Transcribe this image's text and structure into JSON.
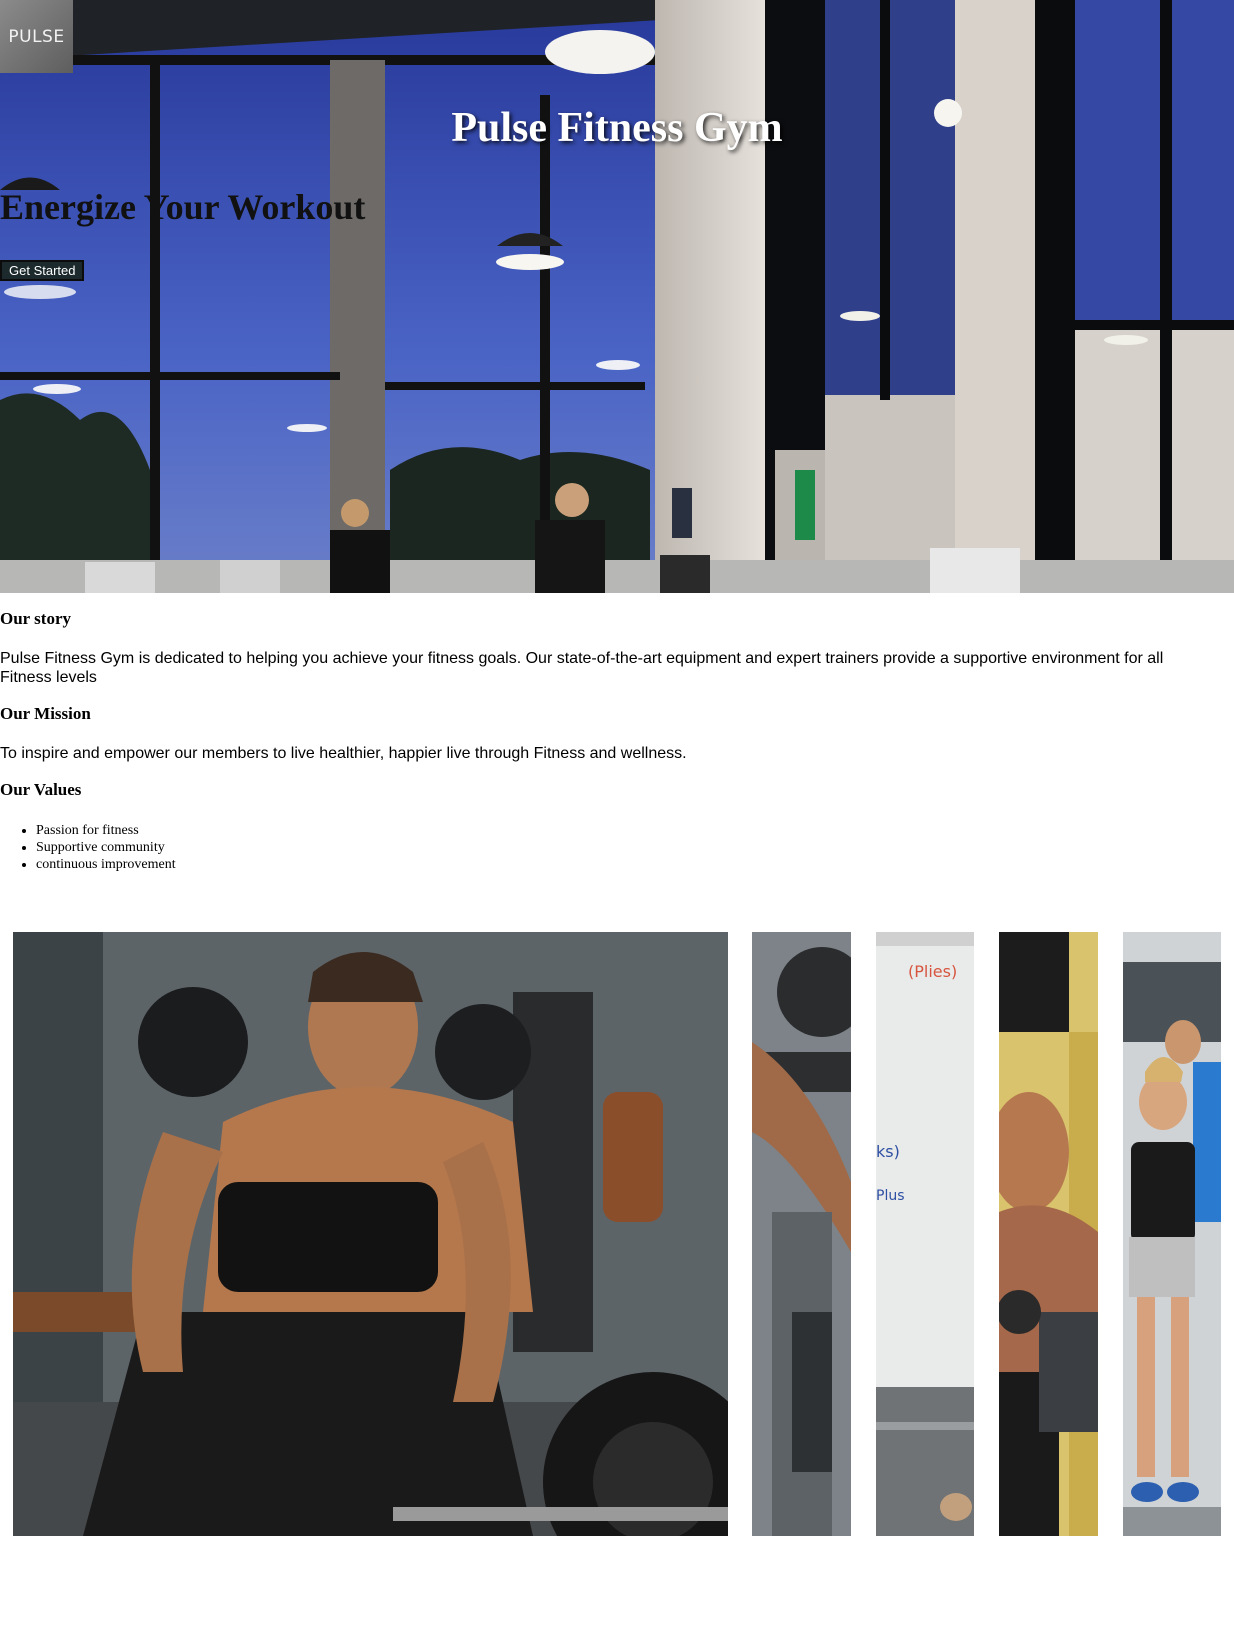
{
  "brand": {
    "logo_text": "PULSE"
  },
  "hero": {
    "title": "Pulse Fitness Gym",
    "tagline": "Energize Your Workout",
    "cta_label": "Get Started"
  },
  "about": {
    "story_heading": "Our story",
    "story_text": "Pulse Fitness Gym is dedicated to helping you achieve your fitness goals. Our state-of-the-art equipment and expert trainers provide a supportive environment for all Fitness levels",
    "mission_heading": "Our Mission",
    "mission_text": "To inspire and empower our members to live healthier, happier live through Fitness and wellness.",
    "values_heading": "Our Values",
    "values": [
      "Passion for fitness",
      "Supportive community",
      "continuous improvement"
    ]
  },
  "gallery": {
    "images": [
      {
        "name": "woman-deadlift-photo"
      },
      {
        "name": "dumbbell-photo"
      },
      {
        "name": "whiteboard-photo"
      },
      {
        "name": "bodybuilders-photo"
      },
      {
        "name": "happy-members-photo"
      }
    ]
  },
  "colors": {
    "cta_bg": "#1c2a2e",
    "logo_bg": "#6e6e6e",
    "hero_sky": "#3c55b8"
  }
}
